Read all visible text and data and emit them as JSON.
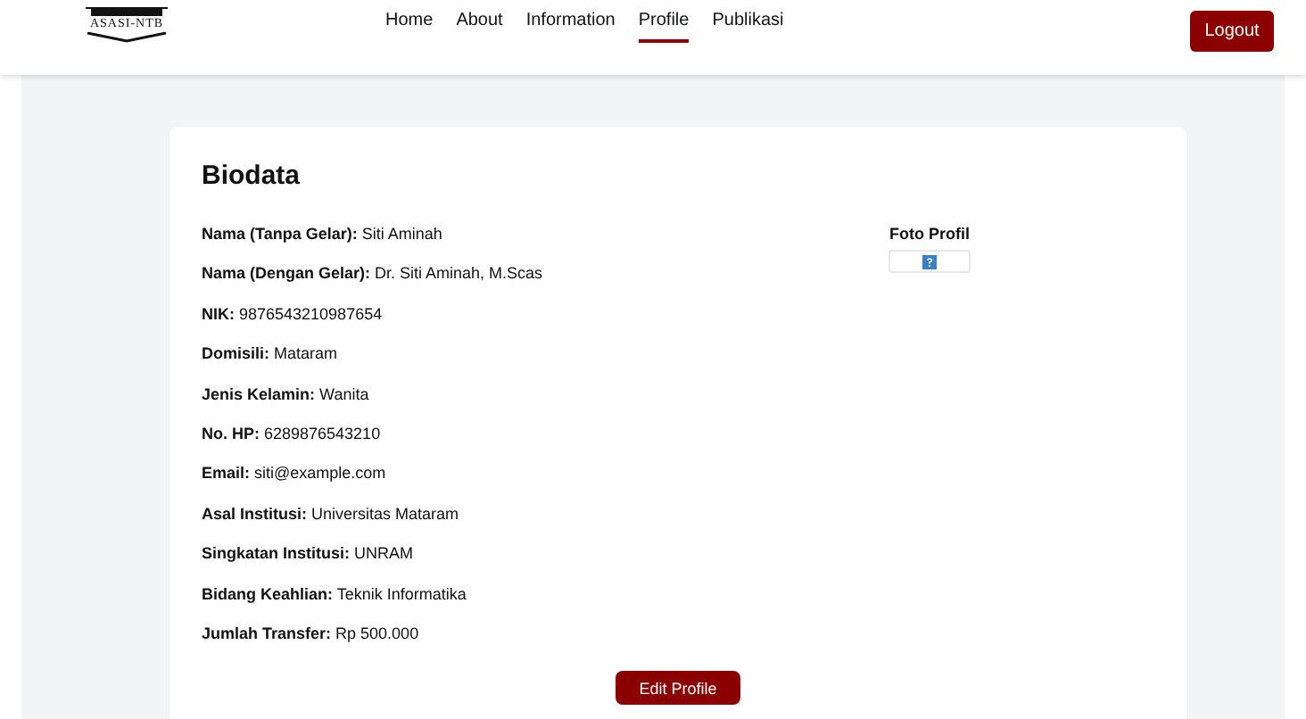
{
  "logo": {
    "text": "ASASI-NTB"
  },
  "nav": [
    {
      "label": "Home",
      "selected": false
    },
    {
      "label": "About",
      "selected": false
    },
    {
      "label": "Information",
      "selected": false
    },
    {
      "label": "Profile",
      "selected": true
    },
    {
      "label": "Publikasi",
      "selected": false
    }
  ],
  "logout_button": "Logout",
  "biodata": {
    "title": "Biodata",
    "fields": [
      {
        "label": "Nama (Tanpa Gelar):",
        "value": "Siti Aminah"
      },
      {
        "label": "Nama (Dengan Gelar):",
        "value": "Dr. Siti Aminah, M.Scas"
      },
      {
        "label": "NIK:",
        "value": "9876543210987654"
      },
      {
        "label": "Domisili:",
        "value": "Mataram"
      },
      {
        "label": "Jenis Kelamin:",
        "value": "Wanita"
      },
      {
        "label": "No. HP:",
        "value": "6289876543210"
      },
      {
        "label": "Email:",
        "value": "siti@example.com"
      },
      {
        "label": "Asal Institusi:",
        "value": "Universitas Mataram"
      },
      {
        "label": "Singkatan Institusi:",
        "value": "UNRAM"
      },
      {
        "label": "Bidang Keahlian:",
        "value": "Teknik Informatika"
      },
      {
        "label": "Jumlah Transfer:",
        "value": "Rp 500.000"
      }
    ],
    "photo_label": "Foto Profil",
    "edit_button": "Edit Profile"
  }
}
